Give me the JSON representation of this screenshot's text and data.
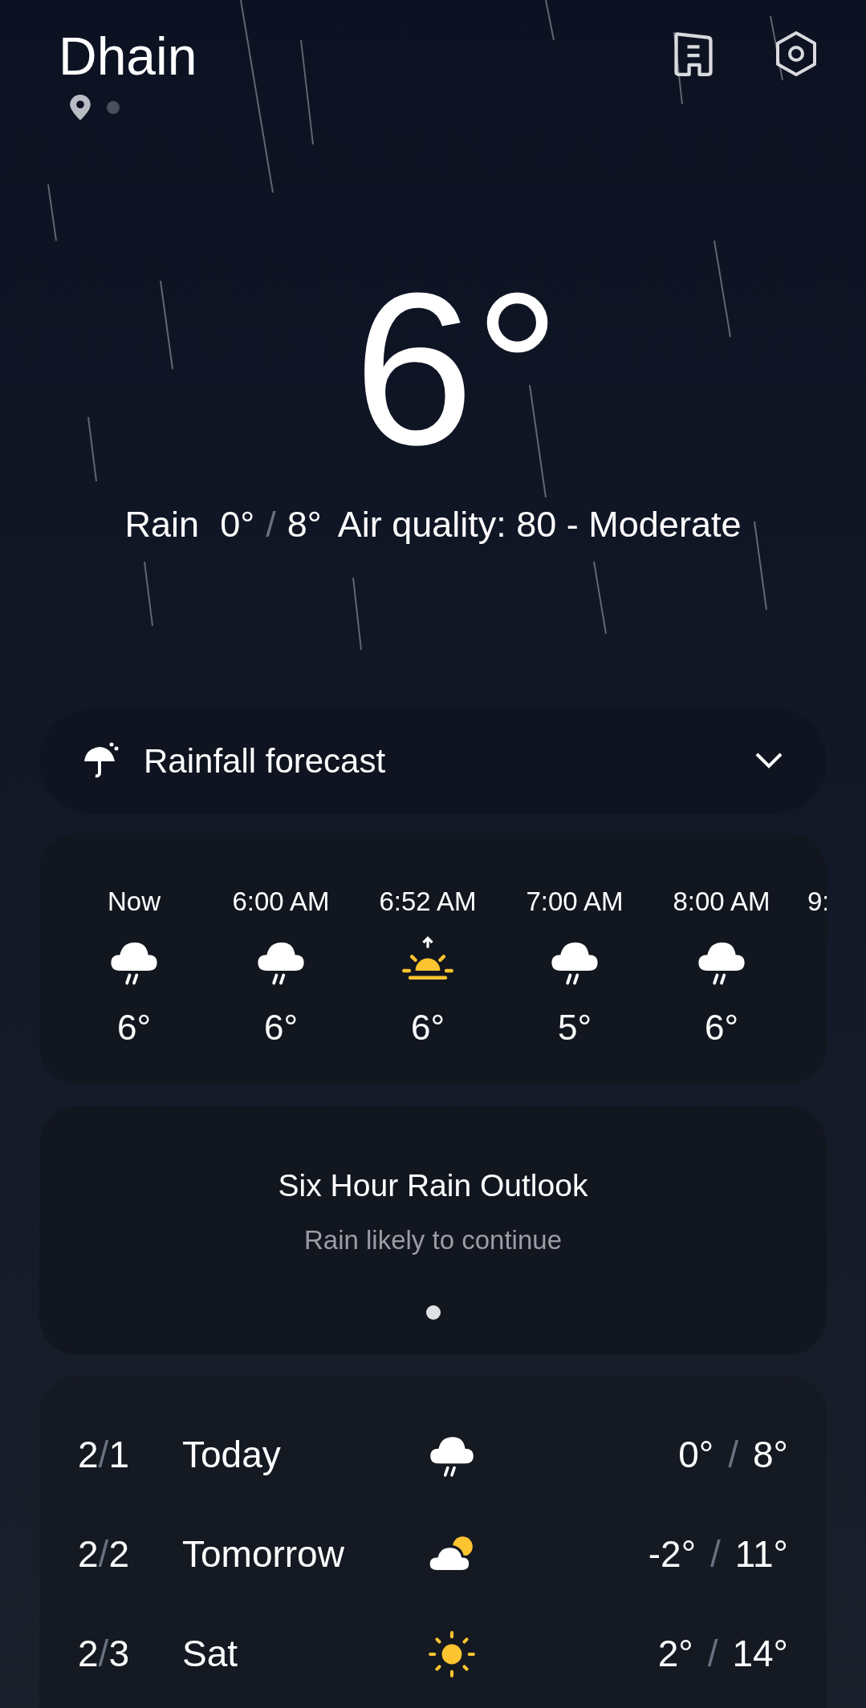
{
  "header": {
    "city": "Dhain"
  },
  "current": {
    "temperature": "6°",
    "condition": "Rain",
    "low": "0°",
    "sep": "/",
    "high": "8°",
    "air_quality": "Air quality: 80 - Moderate"
  },
  "rainfall_forecast": {
    "label": "Rainfall forecast",
    "expanded": false
  },
  "hourly": [
    {
      "time": "Now",
      "kind": "rain",
      "temp": "6°"
    },
    {
      "time": "6:00 AM",
      "kind": "rain",
      "temp": "6°"
    },
    {
      "time": "6:52 AM",
      "kind": "sunrise",
      "temp": "6°"
    },
    {
      "time": "7:00 AM",
      "kind": "rain",
      "temp": "5°"
    },
    {
      "time": "8:00 AM",
      "kind": "rain",
      "temp": "6°"
    },
    {
      "time": "9:",
      "kind": "partial"
    }
  ],
  "outlook": {
    "title": "Six Hour Rain Outlook",
    "subtitle": "Rain likely to continue"
  },
  "daily": [
    {
      "month": "2",
      "date_sep": "/",
      "day": "1",
      "name": "Today",
      "kind": "rain",
      "low": "0°",
      "sep": "/",
      "high": "8°"
    },
    {
      "month": "2",
      "date_sep": "/",
      "day": "2",
      "name": "Tomorrow",
      "kind": "partly_cloudy",
      "low": "-2°",
      "sep": "/",
      "high": "11°"
    },
    {
      "month": "2",
      "date_sep": "/",
      "day": "3",
      "name": "Sat",
      "kind": "sunny",
      "low": "2°",
      "sep": "/",
      "high": "14°"
    }
  ]
}
